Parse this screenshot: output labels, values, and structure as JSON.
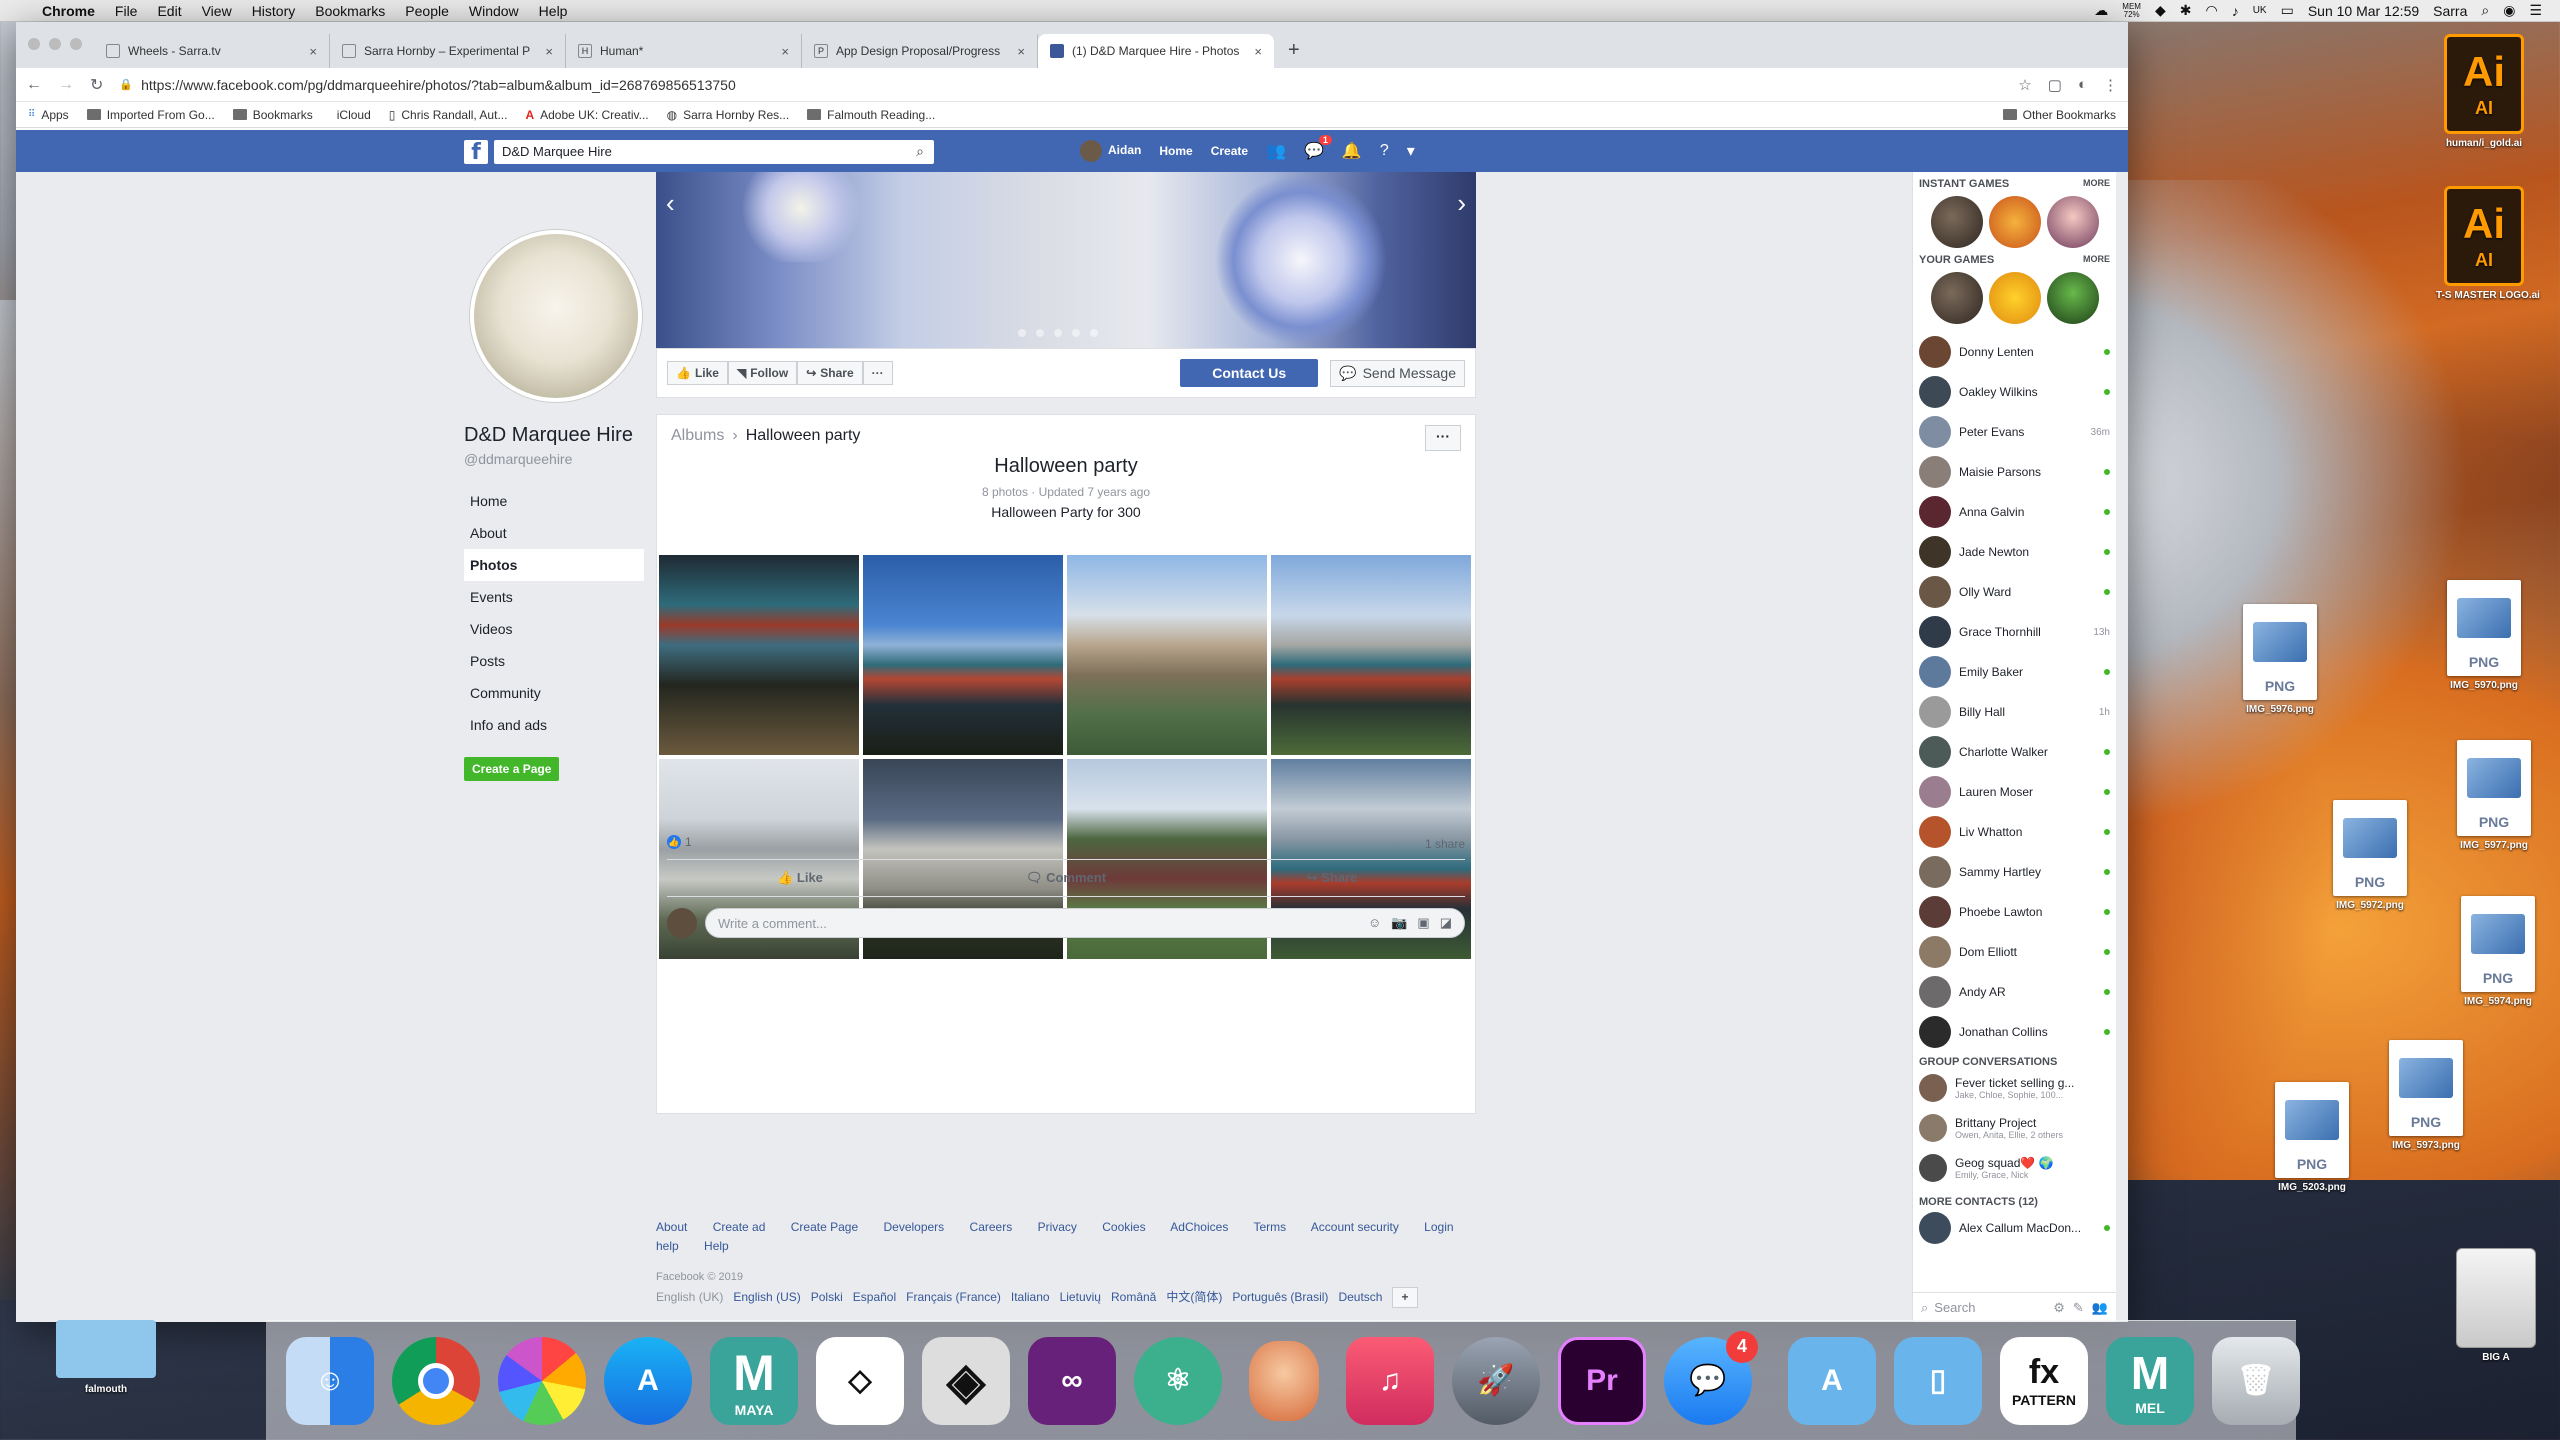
{
  "menubar": {
    "app": "Chrome",
    "items": [
      "File",
      "Edit",
      "View",
      "History",
      "Bookmarks",
      "People",
      "Window",
      "Help"
    ],
    "battery_top": "MEM",
    "battery_val": "72%",
    "flag": "UK",
    "datetime": "Sun 10 Mar  12:59",
    "user": "Sarra"
  },
  "tabs": [
    {
      "title": "Wheels - Sarra.tv",
      "active": false
    },
    {
      "title": "Sarra Hornby – Experimental P",
      "active": false
    },
    {
      "title": "Human*",
      "active": false
    },
    {
      "title": "App Design Proposal/Progress",
      "active": false
    },
    {
      "title": "(1) D&D Marquee Hire - Photos",
      "active": true
    }
  ],
  "address": {
    "url": "https://www.facebook.com/pg/ddmarqueehire/photos/?tab=album&album_id=268769856513750"
  },
  "bookmarks": {
    "items": [
      "Apps",
      "Imported From Go...",
      "Bookmarks",
      "iCloud",
      "Chris Randall, Aut...",
      "Adobe UK: Creativ...",
      "Sarra Hornby Res...",
      "Falmouth Reading..."
    ],
    "other": "Other Bookmarks"
  },
  "fb": {
    "search_value": "D&D Marquee Hire",
    "nav": {
      "user": "Aidan",
      "home": "Home",
      "create": "Create",
      "msg_badge": "1"
    },
    "page_name": "D&D Marquee Hire",
    "handle": "@ddmarqueehire",
    "left_nav": [
      "Home",
      "About",
      "Photos",
      "Events",
      "Videos",
      "Posts",
      "Community",
      "Info and ads"
    ],
    "create_page": "Create a Page",
    "actions": {
      "like": "Like",
      "follow": "Follow",
      "share": "Share",
      "more": "···",
      "contact": "Contact Us",
      "send": "Send Message"
    },
    "album": {
      "crumb_albums": "Albums",
      "crumb_current": "Halloween party",
      "title": "Halloween party",
      "meta": "8 photos · Updated 7 years ago",
      "description": "Halloween Party for 300",
      "reactions": "1",
      "shares": "1 share",
      "like": "Like",
      "comment": "Comment",
      "share": "Share",
      "comment_placeholder": "Write a comment..."
    },
    "footer": {
      "links": [
        "About",
        "Create ad",
        "Create Page",
        "Developers",
        "Careers",
        "Privacy",
        "Cookies",
        "AdChoices",
        "Terms",
        "Account security",
        "Login help",
        "Help"
      ],
      "copyright": "Facebook © 2019",
      "languages": [
        "English (UK)",
        "English (US)",
        "Polski",
        "Español",
        "Français (France)",
        "Italiano",
        "Lietuvių",
        "Română",
        "中文(简体)",
        "Português (Brasil)",
        "Deutsch"
      ]
    },
    "chat": {
      "instant_games": "INSTANT GAMES",
      "your_games": "YOUR GAMES",
      "more": "MORE",
      "contacts": [
        {
          "name": "Donny Lenten",
          "status": "online",
          "color": "#6b4632"
        },
        {
          "name": "Oakley Wilkins",
          "status": "online",
          "color": "#3d4a55"
        },
        {
          "name": "Peter Evans",
          "status": "36m",
          "color": "#7e8da2"
        },
        {
          "name": "Maisie Parsons",
          "status": "online",
          "color": "#8a7f78"
        },
        {
          "name": "Anna Galvin",
          "status": "online",
          "color": "#5a2630"
        },
        {
          "name": "Jade Newton",
          "status": "online",
          "color": "#3e3428"
        },
        {
          "name": "Olly Ward",
          "status": "online",
          "color": "#6b5746"
        },
        {
          "name": "Grace Thornhill",
          "status": "13h",
          "color": "#2f3b48"
        },
        {
          "name": "Emily Baker",
          "status": "online",
          "color": "#5d7a9d"
        },
        {
          "name": "Billy Hall",
          "status": "1h",
          "color": "#9a9a9a"
        },
        {
          "name": "Charlotte Walker",
          "status": "online",
          "color": "#4c5a58"
        },
        {
          "name": "Lauren Moser",
          "status": "online",
          "color": "#9a7e8f"
        },
        {
          "name": "Liv Whatton",
          "status": "online",
          "color": "#b5542c"
        },
        {
          "name": "Sammy Hartley",
          "status": "online",
          "color": "#7a6b5f"
        },
        {
          "name": "Phoebe Lawton",
          "status": "online",
          "color": "#5b3c36"
        },
        {
          "name": "Dom Elliott",
          "status": "online",
          "color": "#8d7a66"
        },
        {
          "name": "Andy AR",
          "status": "online",
          "color": "#6c6a6a"
        },
        {
          "name": "Jonathan Collins",
          "status": "online",
          "color": "#2b2b2b"
        }
      ],
      "group_header": "GROUP CONVERSATIONS",
      "groups": [
        {
          "title": "Fever ticket selling g...",
          "members": "Jake, Chloe, Sophie, 100..."
        },
        {
          "title": "Brittany Project",
          "members": "Owen, Anita, Ellie, 2 others"
        },
        {
          "title": "Geog squad❤️ 🌍",
          "members": "Emily, Grace, Nick"
        }
      ],
      "more_contacts": "MORE CONTACTS (12)",
      "more_contact_name": "Alex Callum MacDon...",
      "search": "Search"
    }
  },
  "desktop": {
    "icons": [
      {
        "label": "human/i_gold.ai"
      },
      {
        "label": "T-S MASTER LOGO.ai"
      },
      {
        "label": "IMG_5976.png"
      },
      {
        "label": "IMG_5970.png"
      },
      {
        "label": "IMG_5972.png"
      },
      {
        "label": "IMG_5977.png"
      },
      {
        "label": "IMG_5974.png"
      },
      {
        "label": "IMG_5203.png"
      },
      {
        "label": "IMG_5973.png"
      },
      {
        "label": "BIG A"
      },
      {
        "label": "falmouth"
      }
    ],
    "png_label": "PNG",
    "ai_label": "Ai",
    "ai_sub": "AI"
  },
  "dock": {
    "maya": "MAYA",
    "pattern": "PATTERN",
    "mel": "MEL",
    "msg_badge": "4"
  }
}
